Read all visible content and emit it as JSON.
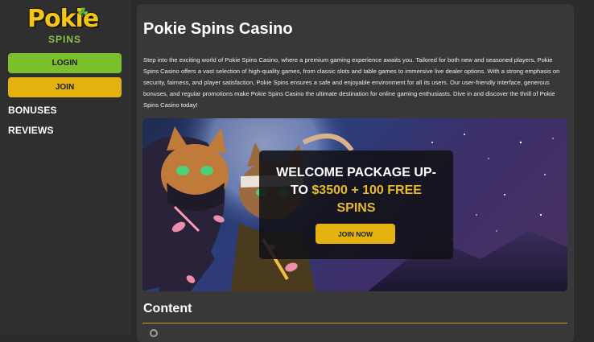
{
  "sidebar": {
    "logo": {
      "word": "Pokie",
      "sub": "SPINS",
      "clover": "☘"
    },
    "login_label": "LOGIN",
    "join_label": "JOIN",
    "nav": [
      {
        "label": "BONUSES"
      },
      {
        "label": "REVIEWS"
      }
    ]
  },
  "main": {
    "title": "Pokie Spins Casino",
    "intro": "Step into the exciting world of Pokie Spins Casino, where a premium gaming experience awaits you. Tailored for both new and seasoned players, Pokie Spins Casino offers a vast selection of high-quality games, from classic slots and table games to immersive live dealer options. With a strong emphasis on security, fairness, and player satisfaction, Pokie Spins ensures a safe and enjoyable environment for all its users. Our user-friendly interface, generous bonuses, and regular promotions make Pokie Spins Casino the ultimate destination for online gaming enthusiasts. Dive in and discover the thrill of Pokie Spins Casino today!",
    "banner": {
      "headline_line1": "WELCOME PACKAGE UP-",
      "headline_to": "TO ",
      "headline_offer": "$3500 + 100 FREE",
      "headline_line3": "SPINS",
      "cta_label": "JOIN NOW"
    },
    "content_heading": "Content"
  },
  "colors": {
    "page_bg": "#2b2b2b",
    "panel_bg": "#383838",
    "login_green": "#7cbf2c",
    "join_gold": "#e3b20f",
    "offer_gold": "#e8b928"
  }
}
